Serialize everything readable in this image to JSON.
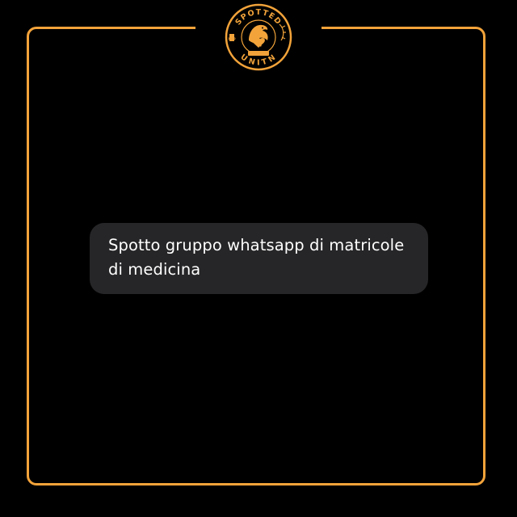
{
  "colors": {
    "background": "#000000",
    "accent": "#f2a33a",
    "bubble": "#262628",
    "text": "#ffffff"
  },
  "logo": {
    "top_text": "SPOTTED",
    "bottom_text": "UNITN",
    "ribbon_text": "TRENTO",
    "side_left": "1962",
    "icons": [
      "eagle-icon",
      "heart-icon",
      "laurel-icon"
    ]
  },
  "message": {
    "text": "Spotto gruppo whatsapp di matricole di medicina"
  }
}
